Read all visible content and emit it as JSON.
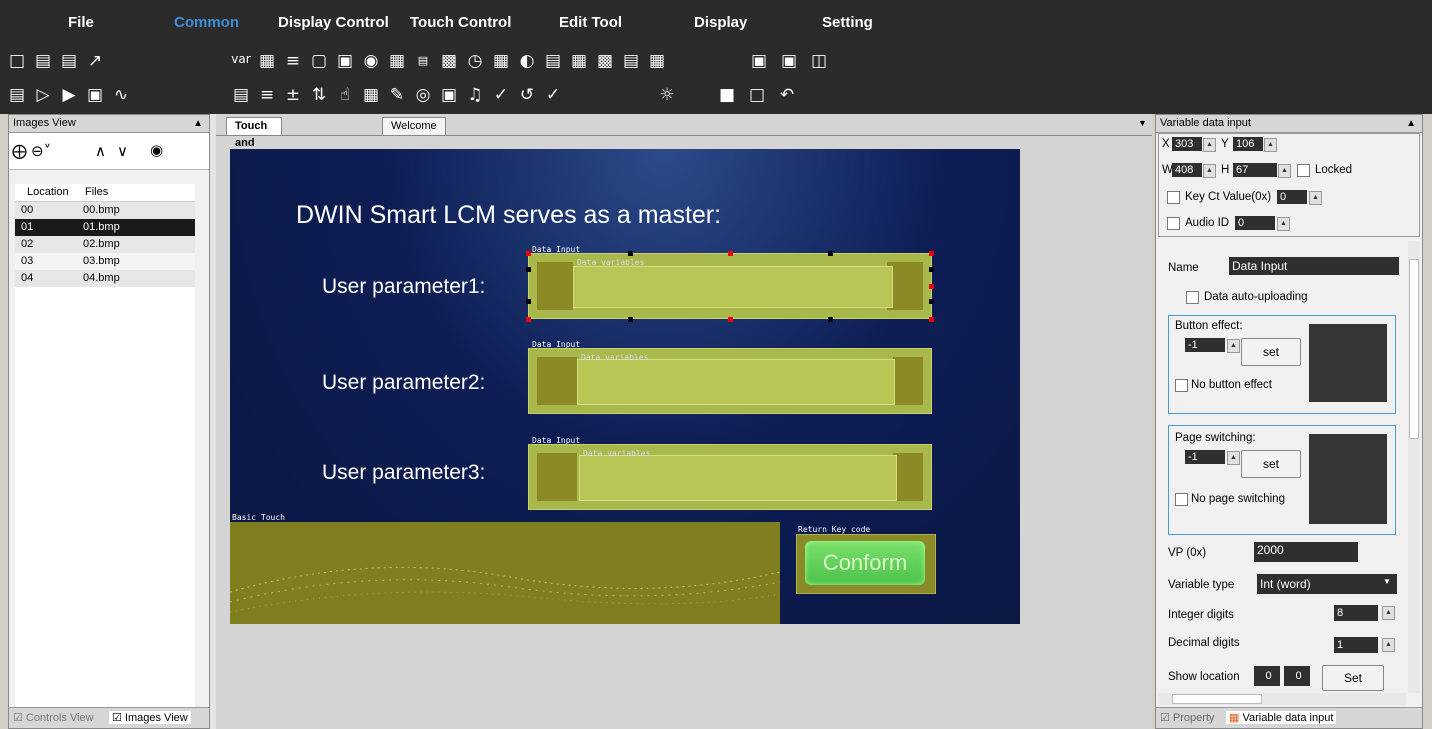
{
  "menu": {
    "file": "File",
    "common": "Common",
    "display_control": "Display Control",
    "touch_control": "Touch Control",
    "edit_tool": "Edit Tool",
    "display": "Display",
    "setting": "Setting"
  },
  "toolbar": {
    "var_label": "var",
    "icons_row1": [
      "new-file-icon",
      "save-icon",
      "save-as-icon",
      "export-icon",
      "variable-icon",
      "image-list-icon",
      "slider-icon",
      "text-box-icon",
      "image-icon",
      "qr-code-icon",
      "date-icon",
      "number-icon",
      "data-variable-icon",
      "clock-icon",
      "calendar-icon",
      "graph-icon",
      "icon-variable-icon",
      "keypad-icon",
      "curve-display-icon",
      "list-icon",
      "chart-icon",
      "copy-icon",
      "paste-icon",
      "delete-icon"
    ],
    "icons_row2": [
      "preview-icon",
      "play-icon",
      "compile-icon",
      "simulator-icon",
      "curve-icon",
      "text-display-icon",
      "list-display-icon",
      "increment-icon",
      "adjust-icon",
      "touch-icon",
      "popup-menu-icon",
      "edit-icon",
      "scroll-icon",
      "camera-icon",
      "audio-icon",
      "check-icon",
      "rotate-icon",
      "slider-touch-icon",
      "brightness-icon",
      "duplicate-icon",
      "copy2-icon",
      "undo-icon"
    ]
  },
  "images_view": {
    "title": "Images View",
    "columns": [
      "Location",
      "Files"
    ],
    "rows": [
      {
        "location": "00",
        "file": "00.bmp"
      },
      {
        "location": "01",
        "file": "01.bmp"
      },
      {
        "location": "02",
        "file": "02.bmp"
      },
      {
        "location": "03",
        "file": "03.bmp"
      },
      {
        "location": "04",
        "file": "04.bmp"
      }
    ],
    "bottom_tabs": [
      "Controls View",
      "Images View"
    ]
  },
  "doc_tabs": [
    "Touch and display config",
    "Welcome"
  ],
  "canvas": {
    "title": "DWIN Smart LCM serves as a master:",
    "params": [
      "User parameter1:",
      "User parameter2:",
      "User parameter3:"
    ],
    "data_input_label": "Data Input",
    "data_variables_label": "Data variables",
    "basic_touch_label": "Basic Touch",
    "return_key_label": "Return Key code",
    "conform": "Conform"
  },
  "right_panel": {
    "title": "Variable data input",
    "x_label": "X",
    "x_value": "303",
    "y_label": "Y",
    "y_value": "106",
    "w_label": "W",
    "w_value": "408",
    "h_label": "H",
    "h_value": "67",
    "locked_label": "Locked",
    "key_ct_label": "Key Ct Value(0x)",
    "key_ct_value": "0",
    "audio_label": "Audio ID",
    "audio_value": "0",
    "name_label": "Name",
    "name_value": "Data Input",
    "auto_upload_label": "Data auto-uploading",
    "button_effect_label": "Button effect:",
    "button_effect_value": "-1",
    "set_label": "set",
    "no_button_effect_label": "No button effect",
    "page_switching_label": "Page switching:",
    "page_switching_value": "-1",
    "no_page_switching_label": "No page switching",
    "vp_label": "VP (0x)",
    "vp_value": "2000",
    "variable_type_label": "Variable type",
    "variable_type_value": "Int (word)",
    "integer_digits_label": "Integer digits",
    "integer_digits_value": "8",
    "decimal_digits_label": "Decimal digits",
    "decimal_digits_value": "1",
    "show_location_label": "Show location",
    "show_x": "0",
    "show_y": "0",
    "set_btn_label": "Set",
    "bottom_tabs": [
      "Property",
      "Variable data input"
    ]
  }
}
